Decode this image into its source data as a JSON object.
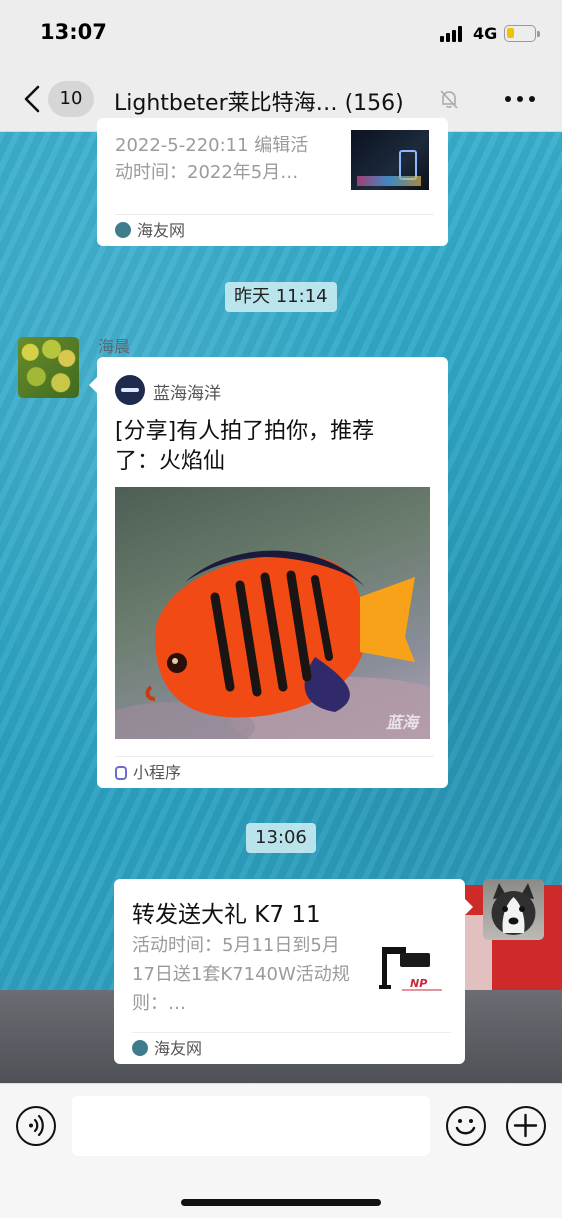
{
  "status_bar": {
    "time": "13:07",
    "network": "4G",
    "battery_level": 0.25
  },
  "nav": {
    "unread_count": "10",
    "title": "Lightbeter莱比特海… (156)"
  },
  "messages": {
    "top_card": {
      "line1": "2022-5-220:11 编辑活",
      "line2": "动时间：2022年5月…",
      "source": "海友网"
    },
    "time_divider_1": "昨天 11:14",
    "mini_program": {
      "sender": "海晨",
      "app_name": "蓝海海洋",
      "title": "[分享]有人拍了拍你，推荐了：火焰仙",
      "image_watermark": "蓝海",
      "footer": "小程序"
    },
    "time_divider_2": "13:06",
    "bottom_card": {
      "title": "转发送大礼 K7 11",
      "desc": "活动时间：5月11日到5月17日送1套K7140W活动规则：…",
      "thumb_brand": "NP",
      "source": "海友网"
    }
  },
  "colors": {
    "accent_link": "#1d8bd6",
    "badge_bg": "#d6d6d6",
    "battery": "#f2c200"
  },
  "icons": {
    "back": "chevron-left-icon",
    "mute": "bell-off-icon",
    "more": "more-dots-icon",
    "voice": "voice-icon",
    "emoji": "emoji-icon",
    "plus": "plus-icon"
  }
}
